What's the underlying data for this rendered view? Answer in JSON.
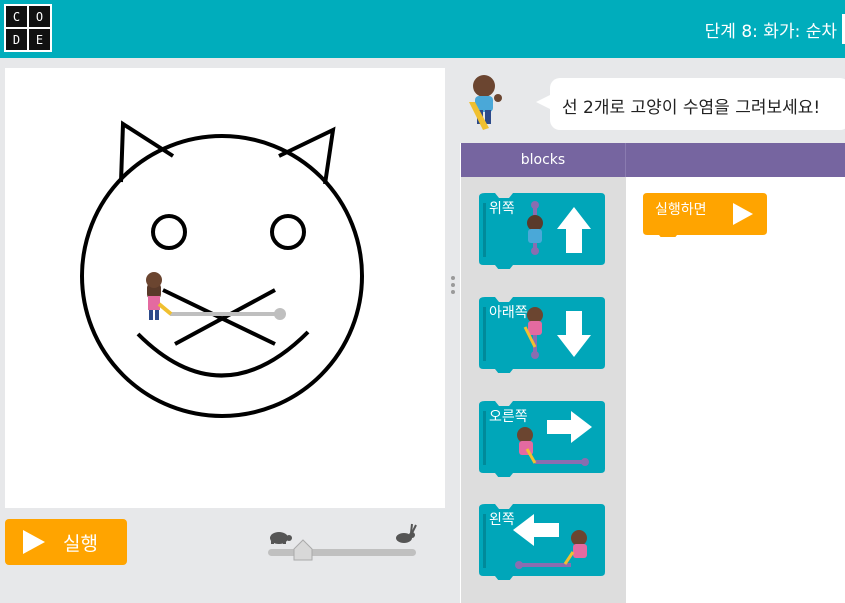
{
  "header": {
    "logo_letters": [
      "C",
      "O",
      "D",
      "E"
    ],
    "stage_title": "단계 8: 화가: 순차",
    "bg_color": "#00adbc"
  },
  "instructions": {
    "text": "선 2개로 고양이 수염을 그려보세요!"
  },
  "tabs": {
    "blocks_label": "blocks"
  },
  "controls": {
    "run_label": "실행",
    "run_color": "#ffa400",
    "speed_slow_icon": "turtle-icon",
    "speed_fast_icon": "rabbit-icon"
  },
  "toolbox": {
    "blocks": [
      {
        "label": "위쪽",
        "arrow": "up",
        "icon": "arrow-up-icon"
      },
      {
        "label": "아래쪽",
        "arrow": "down",
        "icon": "arrow-down-icon"
      },
      {
        "label": "오른쪽",
        "arrow": "right",
        "icon": "arrow-right-icon"
      },
      {
        "label": "왼쪽",
        "arrow": "left",
        "icon": "arrow-left-icon"
      }
    ],
    "block_color": "#00a6b9"
  },
  "workspace": {
    "when_run_label": "실행하면"
  }
}
